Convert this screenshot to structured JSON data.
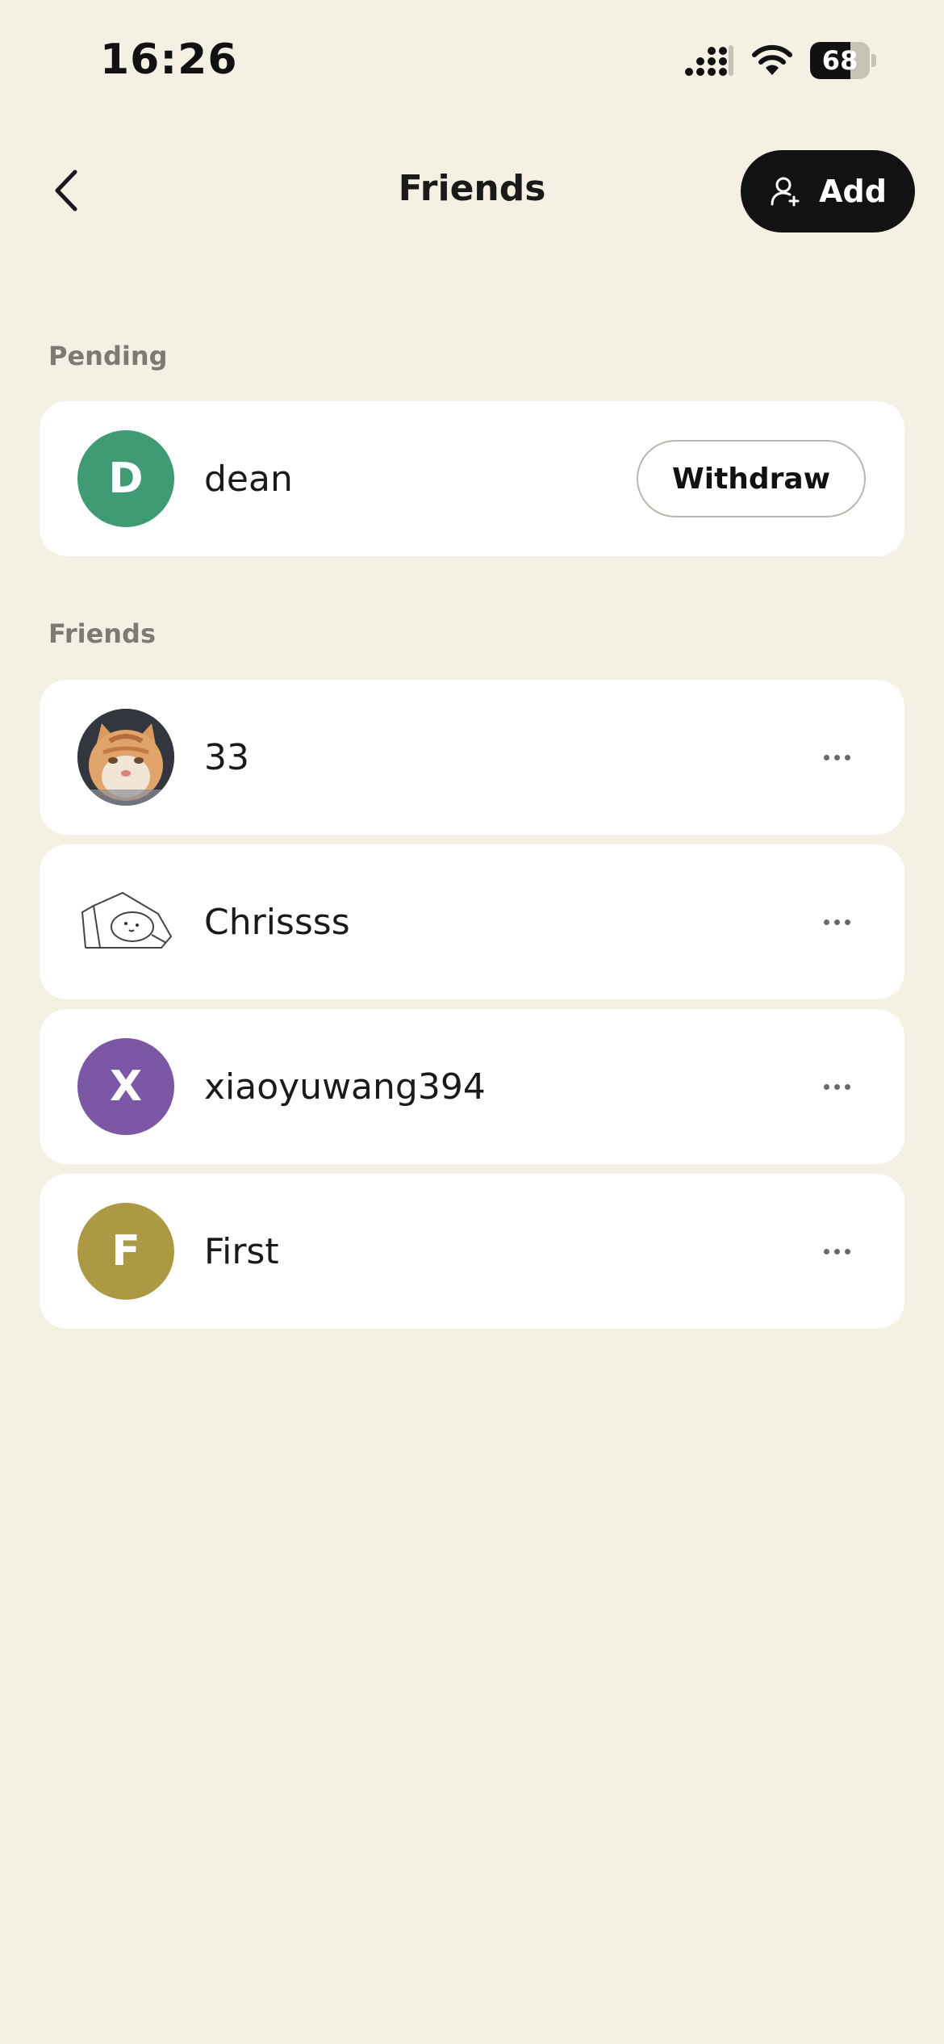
{
  "status_bar": {
    "time": "16:26",
    "battery_level": "68",
    "battery_fraction": 0.68,
    "icons": [
      "cellular-signal-icon",
      "wifi-icon",
      "battery-icon"
    ]
  },
  "header": {
    "back_icon": "chevron-left-icon",
    "title": "Friends",
    "add_label": "Add",
    "add_icon": "add-person-icon"
  },
  "pending": {
    "label": "Pending",
    "items": [
      {
        "initial": "D",
        "name": "dean",
        "avatar_color": "#3f9b74",
        "action_label": "Withdraw"
      }
    ]
  },
  "friends": {
    "label": "Friends",
    "items": [
      {
        "initial": "",
        "name": "33",
        "avatar_type": "photo-cat"
      },
      {
        "initial": "",
        "name": "Chrissss",
        "avatar_type": "sketch-pillow"
      },
      {
        "initial": "X",
        "name": "xiaoyuwang394",
        "avatar_color": "#7b57a6"
      },
      {
        "initial": "F",
        "name": "First",
        "avatar_color": "#ab9a43"
      }
    ]
  },
  "colors": {
    "background": "#f4f0e4",
    "card": "#ffffff",
    "primary_button": "#121212"
  }
}
